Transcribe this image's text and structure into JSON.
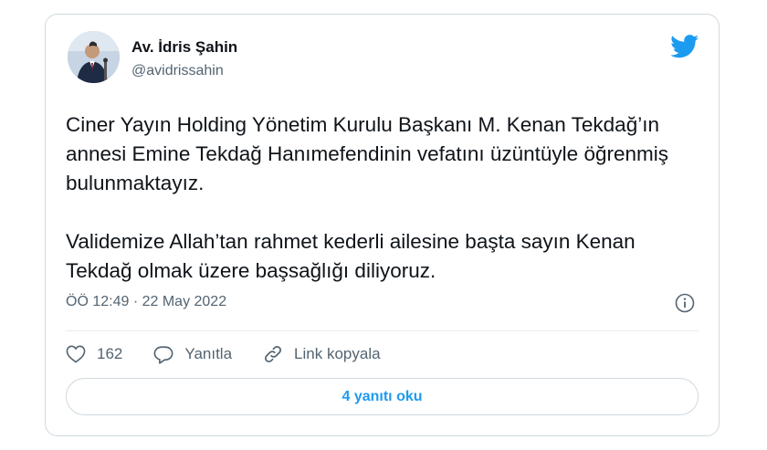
{
  "tweet": {
    "author_name": "Av. İdris Şahin",
    "author_handle": "@avidrissahin",
    "text": "Ciner Yayın Holding Yönetim Kurulu Başkanı M. Kenan Tekdağ’ın annesi Emine Tekdağ Hanımefendinin vefatını üzüntüyle öğrenmiş bulunmaktayız.\n\nValidemize Allah’tan rahmet kederli ailesine başta sayın Kenan Tekdağ olmak üzere başsağlığı diliyoruz.",
    "timestamp": "ÖÖ 12:49 · 22 May 2022"
  },
  "actions": {
    "like_count": "162",
    "reply_label": "Yanıtla",
    "copy_link_label": "Link kopyala"
  },
  "replies_button": "4 yanıtı oku",
  "colors": {
    "accent": "#1d9bf0",
    "secondary_text": "#536471",
    "border": "#cfd9de"
  },
  "icons": [
    "twitter-bird-icon",
    "info-icon",
    "heart-icon",
    "reply-icon",
    "link-icon"
  ]
}
